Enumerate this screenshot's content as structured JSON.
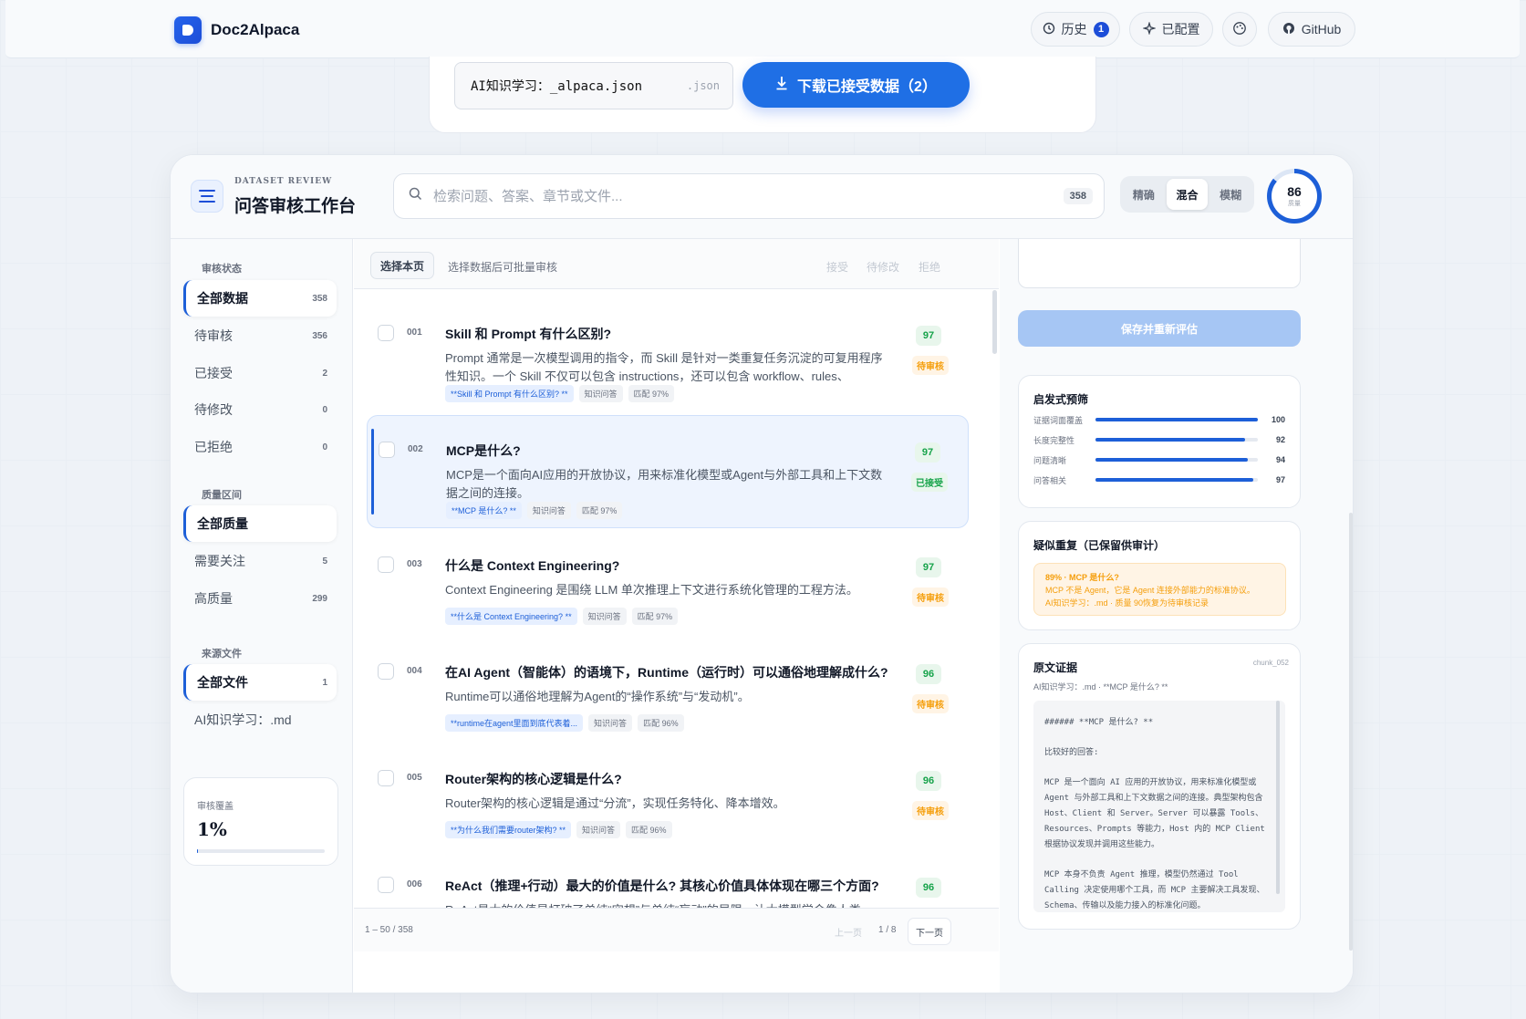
{
  "app": {
    "name": "Doc2Alpaca"
  },
  "topbar": {
    "history_label": "历史",
    "history_count": "1",
    "configured_label": "已配置",
    "github_label": "GitHub"
  },
  "export": {
    "filename": "AI知识学习：_alpaca.json",
    "ext": ".json",
    "download_label": "下载已接受数据（2）"
  },
  "workspace": {
    "eyebrow": "DATASET REVIEW",
    "title": "问答审核工作台",
    "search_placeholder": "检索问题、答案、章节或文件...",
    "search_count": "358",
    "modes": [
      "精确",
      "混合",
      "模糊"
    ],
    "active_mode": "混合",
    "quality_score": "86",
    "quality_label": "质量"
  },
  "sidebar": {
    "status_title": "审核状态",
    "status_items": [
      {
        "label": "全部数据",
        "count": "358"
      },
      {
        "label": "待审核",
        "count": "356"
      },
      {
        "label": "已接受",
        "count": "2"
      },
      {
        "label": "待修改",
        "count": "0"
      },
      {
        "label": "已拒绝",
        "count": "0"
      }
    ],
    "quality_title": "质量区间",
    "quality_items": [
      {
        "label": "全部质量",
        "count": ""
      },
      {
        "label": "需要关注",
        "count": "5"
      },
      {
        "label": "高质量",
        "count": "299"
      }
    ],
    "source_title": "来源文件",
    "source_items": [
      {
        "label": "全部文件",
        "count": "1"
      },
      {
        "label": "AI知识学习：.md",
        "count": ""
      }
    ],
    "coverage_label": "审核覆盖",
    "coverage_value": "1%",
    "coverage_fraction": 0.01
  },
  "list_toolbar": {
    "select_page": "选择本页",
    "hint": "选择数据后可批量审核",
    "accept": "接受",
    "revise": "待修改",
    "reject": "拒绝"
  },
  "items": [
    {
      "no": "001",
      "question": "Skill 和 Prompt 有什么区别?",
      "answer": "Prompt 通常是一次模型调用的指令，而 Skill 是针对一类重复任务沉淀的可复用程序性知识。一个 Skill 不仅可以包含 instructions，还可以包含 workflow、rules、examples...",
      "tags": [
        "**Skill 和 Prompt 有什么区别? **",
        "知识问答",
        "匹配 97%"
      ],
      "score": "97",
      "status": "待审核",
      "accepted": false
    },
    {
      "no": "002",
      "question": "MCP是什么?",
      "answer": "MCP是一个面向AI应用的开放协议，用来标准化模型或Agent与外部工具和上下文数据之间的连接。",
      "tags": [
        "**MCP 是什么? **",
        "知识问答",
        "匹配 97%"
      ],
      "score": "97",
      "status": "已接受",
      "accepted": true
    },
    {
      "no": "003",
      "question": "什么是 Context Engineering?",
      "answer": "Context Engineering 是围绕 LLM 单次推理上下文进行系统化管理的工程方法。",
      "tags": [
        "**什么是 Context Engineering? **",
        "知识问答",
        "匹配 97%"
      ],
      "score": "97",
      "status": "待审核",
      "accepted": false
    },
    {
      "no": "004",
      "question": "在AI Agent（智能体）的语境下，Runtime（运行时）可以通俗地理解成什么?",
      "answer": "Runtime可以通俗地理解为Agent的“操作系统”与“发动机”。",
      "tags": [
        "**runtime在agent里面到底代表着...",
        "知识问答",
        "匹配 96%"
      ],
      "score": "96",
      "status": "待审核",
      "accepted": false
    },
    {
      "no": "005",
      "question": "Router架构的核心逻辑是什么?",
      "answer": "Router架构的核心逻辑是通过“分流”，实现任务特化、降本增效。",
      "tags": [
        "**为什么我们需要router架构? **",
        "知识问答",
        "匹配 96%"
      ],
      "score": "96",
      "status": "待审核",
      "accepted": false
    },
    {
      "no": "006",
      "question": "ReAct（推理+行动）最大的价值是什么? 其核心价值具体体现在哪三个方面?",
      "answer": "ReAct最大的价值是打破了单纯“空想”与单纯“盲动”的局限，让大模型学会像人类一样“边",
      "tags": [],
      "score": "96",
      "status": "待审核",
      "accepted": false
    }
  ],
  "pager": {
    "range": "1 – 50 / 358",
    "prev": "上一页",
    "page": "1 / 8",
    "next": "下一页"
  },
  "detail": {
    "save_label": "保存并重新评估",
    "heuristic_title": "启发式预筛",
    "metrics": [
      {
        "label": "证据词面覆盖",
        "value": 100
      },
      {
        "label": "长度完整性",
        "value": 92
      },
      {
        "label": "问题清晰",
        "value": 94
      },
      {
        "label": "问答相关",
        "value": 97
      }
    ],
    "dup_title": "疑似重复（已保留供审计）",
    "dup_lines": [
      "89% · MCP 是什么?",
      "MCP 不是 Agent，它是 Agent 连接外部能力的标准协议。",
      "AI知识学习：.md · 质量 90恢复为待审核记录"
    ],
    "evidence_title": "原文证据",
    "evidence_id": "chunk_052",
    "evidence_source": "AI知识学习：.md · **MCP 是什么? **",
    "evidence_paras": [
      "###### **MCP 是什么? **",
      "比较好的回答:",
      "MCP 是一个面向 AI 应用的开放协议，用来标准化模型或 Agent 与外部工具和上下文数据之间的连接。典型架构包含 Host、Client 和 Server。Server 可以暴露 Tools、Resources、Prompts 等能力，Host 内的 MCP Client 根据协议发现并调用这些能力。",
      "MCP 本身不负责 Agent 推理，模型仍然通过 Tool Calling 决定使用哪个工具，而 MCP 主要解决工具发现、Schema、传输以及能力接入的标准化问题。"
    ]
  }
}
